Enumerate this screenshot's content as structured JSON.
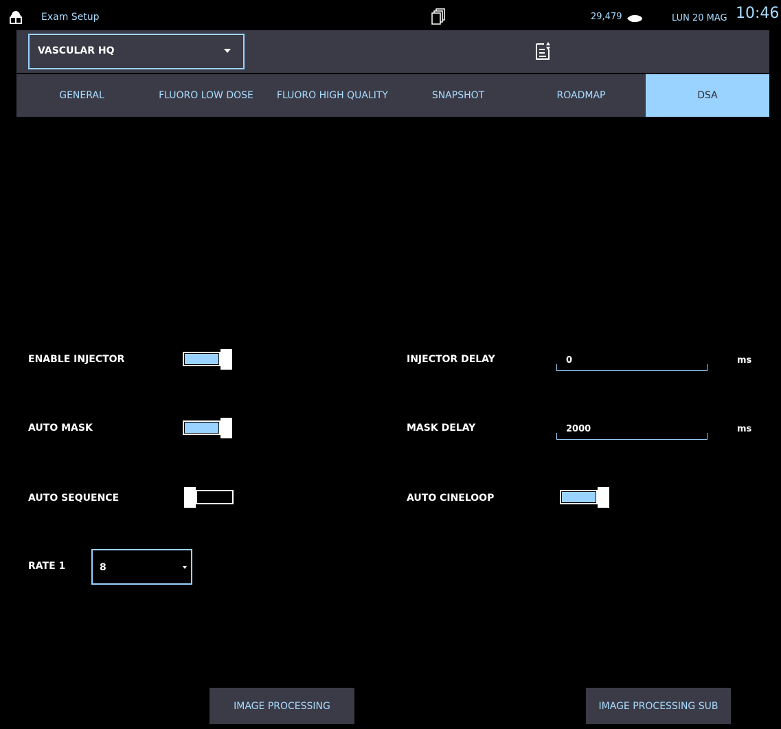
{
  "statusbar": {
    "title": "Exam Setup",
    "counter": "29,479",
    "date": "LUN 20 MAG",
    "time": "10:46"
  },
  "preset": {
    "selected": "VASCULAR HQ"
  },
  "tabs": [
    {
      "label": "GENERAL",
      "active": false
    },
    {
      "label": "FLUORO LOW DOSE",
      "active": false
    },
    {
      "label": "FLUORO HIGH QUALITY",
      "active": false
    },
    {
      "label": "SNAPSHOT",
      "active": false
    },
    {
      "label": "ROADMAP",
      "active": false
    },
    {
      "label": "DSA",
      "active": true
    }
  ],
  "form": {
    "enable_injector": {
      "label": "ENABLE INJECTOR",
      "on": true
    },
    "auto_mask": {
      "label": "AUTO MASK",
      "on": true
    },
    "auto_sequence": {
      "label": "AUTO SEQUENCE",
      "on": false
    },
    "auto_cineloop": {
      "label": "AUTO CINELOOP",
      "on": true
    },
    "injector_delay": {
      "label": "INJECTOR DELAY",
      "value": "0",
      "unit": "ms"
    },
    "mask_delay": {
      "label": "MASK DELAY",
      "value": "2000",
      "unit": "ms"
    },
    "rate1": {
      "label": "RATE 1",
      "value": "8"
    }
  },
  "buttons": {
    "image_processing": "IMAGE PROCESSING",
    "image_processing_sub": "IMAGE PROCESSING SUB"
  },
  "colors": {
    "accent": "#9ad3ff",
    "panel": "#3b3b47",
    "background": "#000000"
  }
}
